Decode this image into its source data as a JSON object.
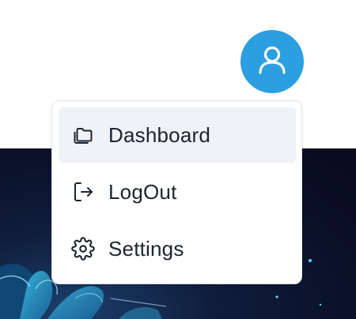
{
  "user_menu": {
    "avatar_icon": "user-icon",
    "avatar_color": "#2b9fe0",
    "items": [
      {
        "label": "Dashboard",
        "icon": "folders-icon",
        "active": true
      },
      {
        "label": "LogOut",
        "icon": "log-out-icon",
        "active": false
      },
      {
        "label": "Settings",
        "icon": "gear-icon",
        "active": false
      }
    ]
  },
  "colors": {
    "menu_hover_bg": "#eff2f7",
    "text": "#1c2430",
    "hero_bg": "#0a1028"
  }
}
